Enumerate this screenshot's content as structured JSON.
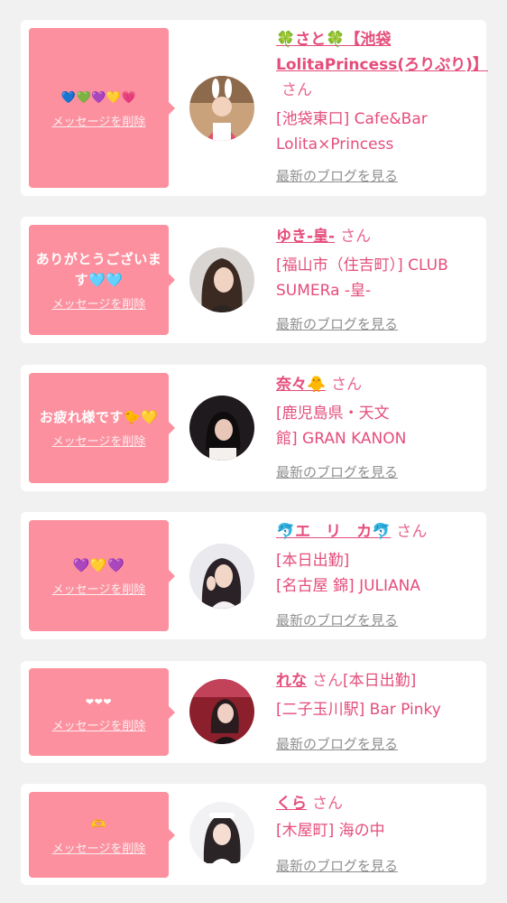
{
  "colors": {
    "background": "#f1f1f1",
    "card": "#ffffff",
    "bubble": "#fc909f",
    "accent_pink": "#e54d7b",
    "blog_link": "#8f8f8f"
  },
  "messages": [
    {
      "text": "💙💚💜💛💗",
      "delete_label": "メッセージを削除",
      "name": "🍀さと🍀【池袋LolitaPrincess(ろりぷり)】",
      "honorific": "さん",
      "shop_lines": [
        "[池袋東口] Cafe&Bar",
        "Lolita×Princess"
      ],
      "blog_label": "最新のブログを見る",
      "avatar_icon": "user-photo-avatar"
    },
    {
      "text": "ありがとうございます🩵🩵",
      "delete_label": "メッセージを削除",
      "name": "ゆき-皇-",
      "honorific": "さん",
      "shop_lines": [
        "[福山市（住吉町）] CLUB",
        "SUMERa -皇-"
      ],
      "blog_label": "最新のブログを見る",
      "avatar_icon": "user-photo-avatar"
    },
    {
      "text": "お疲れ様です🐤💛",
      "delete_label": "メッセージを削除",
      "name": "奈々🐥",
      "honorific": "さん",
      "shop_lines": [
        "[鹿児島県・天文",
        "館] GRAN KANON"
      ],
      "blog_label": "最新のブログを見る",
      "avatar_icon": "user-photo-avatar"
    },
    {
      "text": "💜💛💜",
      "delete_label": "メッセージを削除",
      "name": "🐬エ　リ　カ🐬",
      "honorific": "さん",
      "shop_lines": [
        "[本日出勤]",
        "[名古屋 錦] JULIANA"
      ],
      "blog_label": "最新のブログを見る",
      "avatar_icon": "user-photo-avatar"
    },
    {
      "text": "❤❤❤",
      "delete_label": "メッセージを削除",
      "name": "れな",
      "honorific": "さん",
      "shop_lines": [
        "[本日出勤]",
        "[二子玉川駅] Bar Pinky"
      ],
      "blog_label": "最新のブログを見る",
      "avatar_icon": "user-photo-avatar"
    },
    {
      "text": "🫶",
      "delete_label": "メッセージを削除",
      "name": "くら",
      "honorific": "さん",
      "shop_lines": [
        "[木屋町] 海の中"
      ],
      "blog_label": "最新のブログを見る",
      "avatar_icon": "user-photo-avatar"
    }
  ]
}
